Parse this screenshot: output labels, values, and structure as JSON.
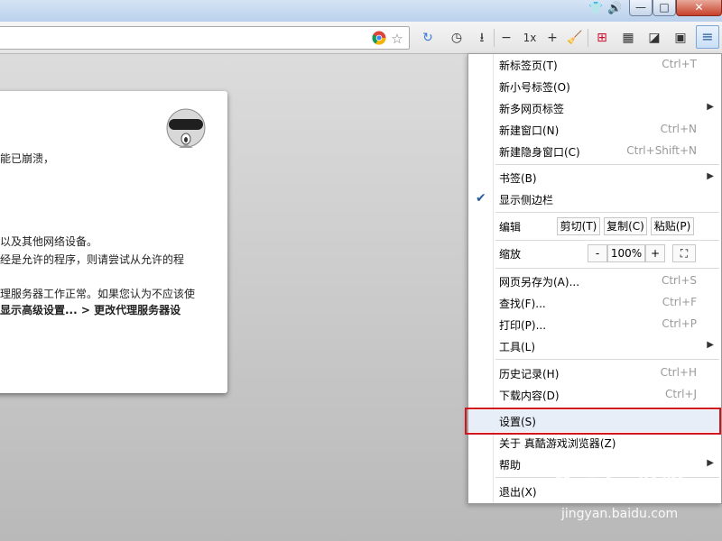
{
  "tray": {
    "tshirt_icon": "tshirt-icon",
    "speaker_icon": "speaker-icon"
  },
  "window_controls": {
    "minimize": "—",
    "maximize": "□",
    "close": "✕"
  },
  "toolbar": {
    "zoom_label": "1x"
  },
  "error_page": {
    "lines": [
      "能已崩溃，",
      "以及其他网络设备。",
      "经是允许的程序，则请尝试从允许的程",
      "理服务器工作正常。如果您认为不应该使",
      "显示高级设置... > 更改代理服务器设"
    ]
  },
  "menu": {
    "items": [
      {
        "label": "新标签页(T)",
        "shortcut": "Ctrl+T"
      },
      {
        "label": "新小号标签(O)",
        "shortcut": ""
      },
      {
        "label": "新多网页标签",
        "shortcut": ""
      },
      {
        "label": "新建窗口(N)",
        "shortcut": "Ctrl+N"
      },
      {
        "label": "新建隐身窗口(C)",
        "shortcut": "Ctrl+Shift+N"
      },
      {
        "label": "书签(B)",
        "shortcut": ""
      },
      {
        "label": "显示侧边栏",
        "shortcut": ""
      },
      {
        "label": "编辑",
        "shortcut": ""
      },
      {
        "label": "缩放",
        "shortcut": ""
      },
      {
        "label": "网页另存为(A)...",
        "shortcut": "Ctrl+S"
      },
      {
        "label": "查找(F)...",
        "shortcut": "Ctrl+F"
      },
      {
        "label": "打印(P)...",
        "shortcut": "Ctrl+P"
      },
      {
        "label": "工具(L)",
        "shortcut": ""
      },
      {
        "label": "历史记录(H)",
        "shortcut": "Ctrl+H"
      },
      {
        "label": "下载内容(D)",
        "shortcut": "Ctrl+J"
      },
      {
        "label": "设置(S)",
        "shortcut": ""
      },
      {
        "label": "关于 真酷游戏浏览器(Z)",
        "shortcut": ""
      },
      {
        "label": "帮助",
        "shortcut": ""
      },
      {
        "label": "退出(X)",
        "shortcut": ""
      }
    ],
    "edit": {
      "cut": "剪切(T)",
      "copy": "复制(C)",
      "paste": "粘贴(P)"
    },
    "zoom": {
      "minus": "-",
      "value": "100%",
      "plus": "+"
    }
  },
  "watermark": {
    "brand": "Baidu 经验",
    "url": "jingyan.baidu.com"
  },
  "colors": {
    "accent": "#2a5d9f",
    "highlight_box": "#d0141e"
  }
}
